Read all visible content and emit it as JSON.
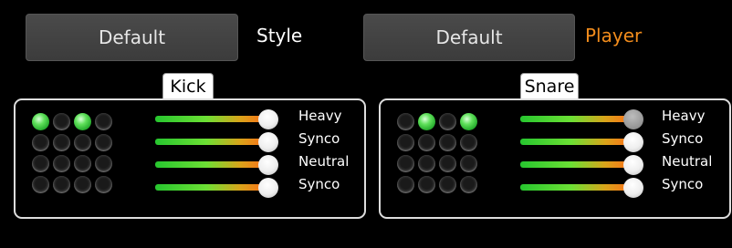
{
  "header": {
    "style_button": "Default",
    "style_label": "Style",
    "player_button": "Default",
    "player_label": "Player",
    "player_label_color": "#f28c1c",
    "style_label_color": "#ffffff"
  },
  "kick": {
    "title": "Kick",
    "grid": [
      [
        true,
        false,
        true,
        false
      ],
      [
        false,
        false,
        false,
        false
      ],
      [
        false,
        false,
        false,
        false
      ],
      [
        false,
        false,
        false,
        false
      ]
    ],
    "sliders": [
      {
        "label": "Heavy",
        "value": 1.0
      },
      {
        "label": "Synco",
        "value": 1.0
      },
      {
        "label": "Neutral",
        "value": 1.0
      },
      {
        "label": "Synco",
        "value": 1.0
      }
    ]
  },
  "snare": {
    "title": "Snare",
    "grid": [
      [
        false,
        true,
        false,
        true
      ],
      [
        false,
        false,
        false,
        false
      ],
      [
        false,
        false,
        false,
        false
      ],
      [
        false,
        false,
        false,
        false
      ]
    ],
    "sliders": [
      {
        "label": "Heavy",
        "value": 1.0,
        "dimmed": true
      },
      {
        "label": "Synco",
        "value": 1.0
      },
      {
        "label": "Neutral",
        "value": 1.0
      },
      {
        "label": "Synco",
        "value": 1.0
      }
    ]
  }
}
